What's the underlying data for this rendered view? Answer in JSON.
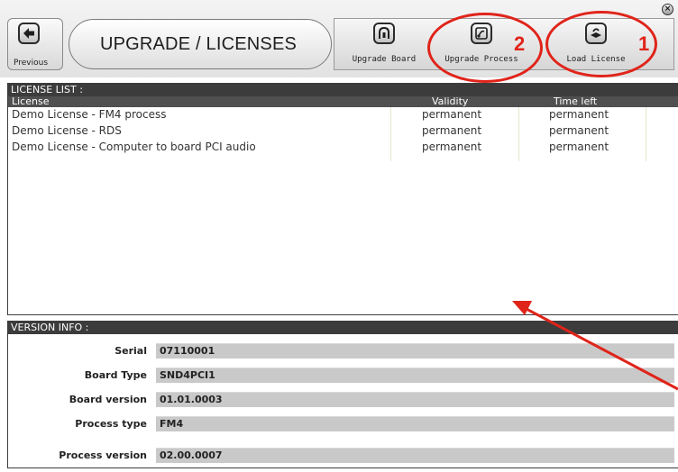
{
  "toolbar": {
    "previous_label": "Previous",
    "title": "UPGRADE / LICENSES",
    "upgrade_board_label": "Upgrade Board",
    "upgrade_process_label": "Upgrade Process",
    "load_license_label": "Load License",
    "close_glyph": "×"
  },
  "annotations": {
    "marker_1": "1",
    "marker_2": "2",
    "color": "#e0241a"
  },
  "license_list": {
    "header": "LICENSE LIST :",
    "columns": {
      "license": "License",
      "validity": "Validity",
      "time_left": "Time left"
    },
    "rows": [
      {
        "license": "Demo License - FM4 process",
        "validity": "permanent",
        "time_left": "permanent"
      },
      {
        "license": "Demo License - RDS",
        "validity": "permanent",
        "time_left": "permanent"
      },
      {
        "license": "Demo License - Computer to board PCI audio",
        "validity": "permanent",
        "time_left": "permanent"
      }
    ]
  },
  "version_info": {
    "header": "VERSION INFO :",
    "fields": [
      {
        "label": "Serial",
        "value": "07110001"
      },
      {
        "label": "Board Type",
        "value": "SND4PCI1"
      },
      {
        "label": "Board version",
        "value": "01.01.0003"
      },
      {
        "label": "Process type",
        "value": "FM4"
      },
      {
        "label": "Process version",
        "value": "02.00.0007"
      }
    ]
  },
  "icons": {
    "previous": "arrow-left-icon",
    "upgrade_board": "board-icon",
    "upgrade_process": "process-icon",
    "load_license": "license-icon",
    "close": "close-icon"
  }
}
